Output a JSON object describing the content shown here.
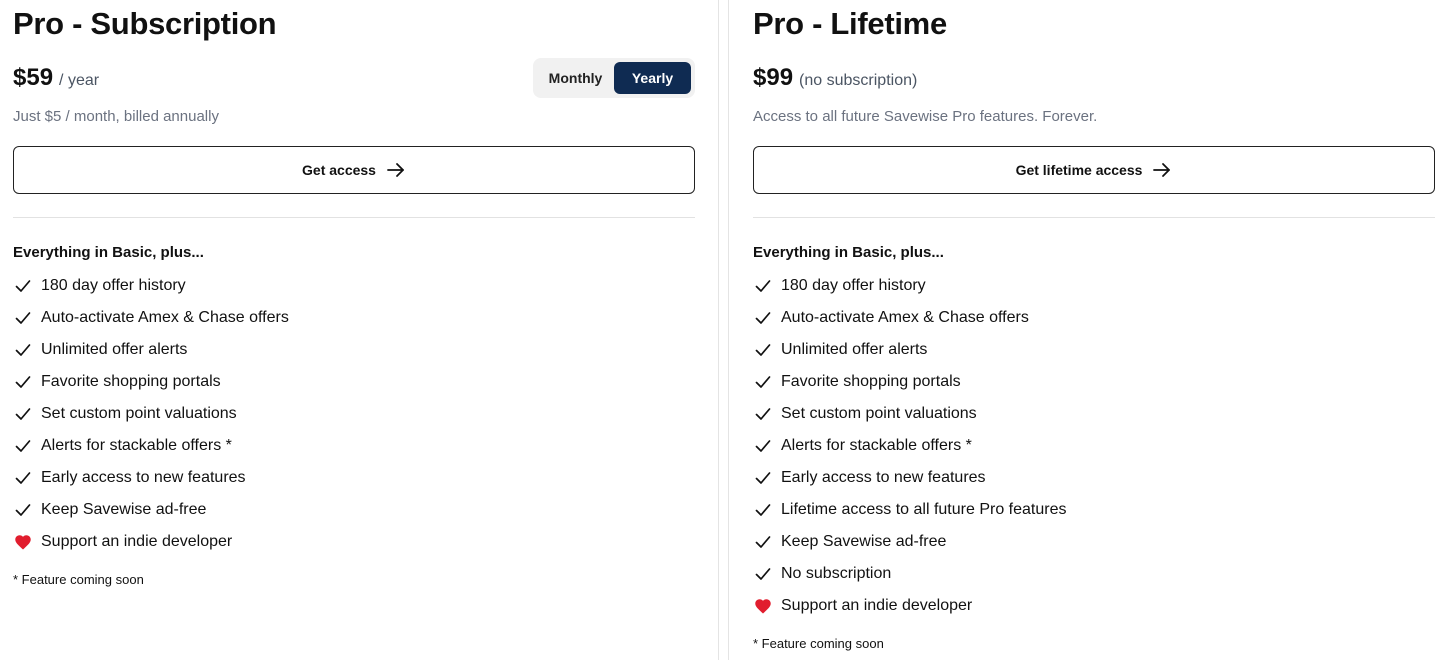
{
  "subscription": {
    "title": "Pro - Subscription",
    "price": "$59",
    "period": "/ year",
    "tagline": "Just $5 / month, billed annually",
    "toggle": {
      "monthly_label": "Monthly",
      "yearly_label": "Yearly",
      "selected": "Yearly"
    },
    "cta_label": "Get access",
    "features_heading": "Everything in Basic, plus...",
    "features": [
      {
        "icon": "check-icon",
        "text": "180 day offer history"
      },
      {
        "icon": "check-icon",
        "text": "Auto-activate Amex & Chase offers"
      },
      {
        "icon": "check-icon",
        "text": "Unlimited offer alerts"
      },
      {
        "icon": "check-icon",
        "text": "Favorite shopping portals"
      },
      {
        "icon": "check-icon",
        "text": "Set custom point valuations"
      },
      {
        "icon": "check-icon",
        "text": "Alerts for stackable offers *"
      },
      {
        "icon": "check-icon",
        "text": "Early access to new features"
      },
      {
        "icon": "check-icon",
        "text": "Keep Savewise ad-free"
      },
      {
        "icon": "heart-icon",
        "text": "Support an indie developer"
      }
    ],
    "footnote": "* Feature coming soon"
  },
  "lifetime": {
    "title": "Pro - Lifetime",
    "price": "$99",
    "period": "(no subscription)",
    "tagline": "Access to all future Savewise Pro features. Forever.",
    "cta_label": "Get lifetime access",
    "features_heading": "Everything in Basic, plus...",
    "features": [
      {
        "icon": "check-icon",
        "text": "180 day offer history"
      },
      {
        "icon": "check-icon",
        "text": "Auto-activate Amex & Chase offers"
      },
      {
        "icon": "check-icon",
        "text": "Unlimited offer alerts"
      },
      {
        "icon": "check-icon",
        "text": "Favorite shopping portals"
      },
      {
        "icon": "check-icon",
        "text": "Set custom point valuations"
      },
      {
        "icon": "check-icon",
        "text": "Alerts for stackable offers *"
      },
      {
        "icon": "check-icon",
        "text": "Early access to new features"
      },
      {
        "icon": "check-icon",
        "text": "Lifetime access to all future Pro features"
      },
      {
        "icon": "check-icon",
        "text": "Keep Savewise ad-free"
      },
      {
        "icon": "check-icon",
        "text": "No subscription"
      },
      {
        "icon": "heart-icon",
        "text": "Support an indie developer"
      }
    ],
    "footnote": "* Feature coming soon"
  },
  "colors": {
    "toggle_active_bg": "#0f2b52",
    "heart": "#e11d2e",
    "muted_text": "#6b7280"
  }
}
